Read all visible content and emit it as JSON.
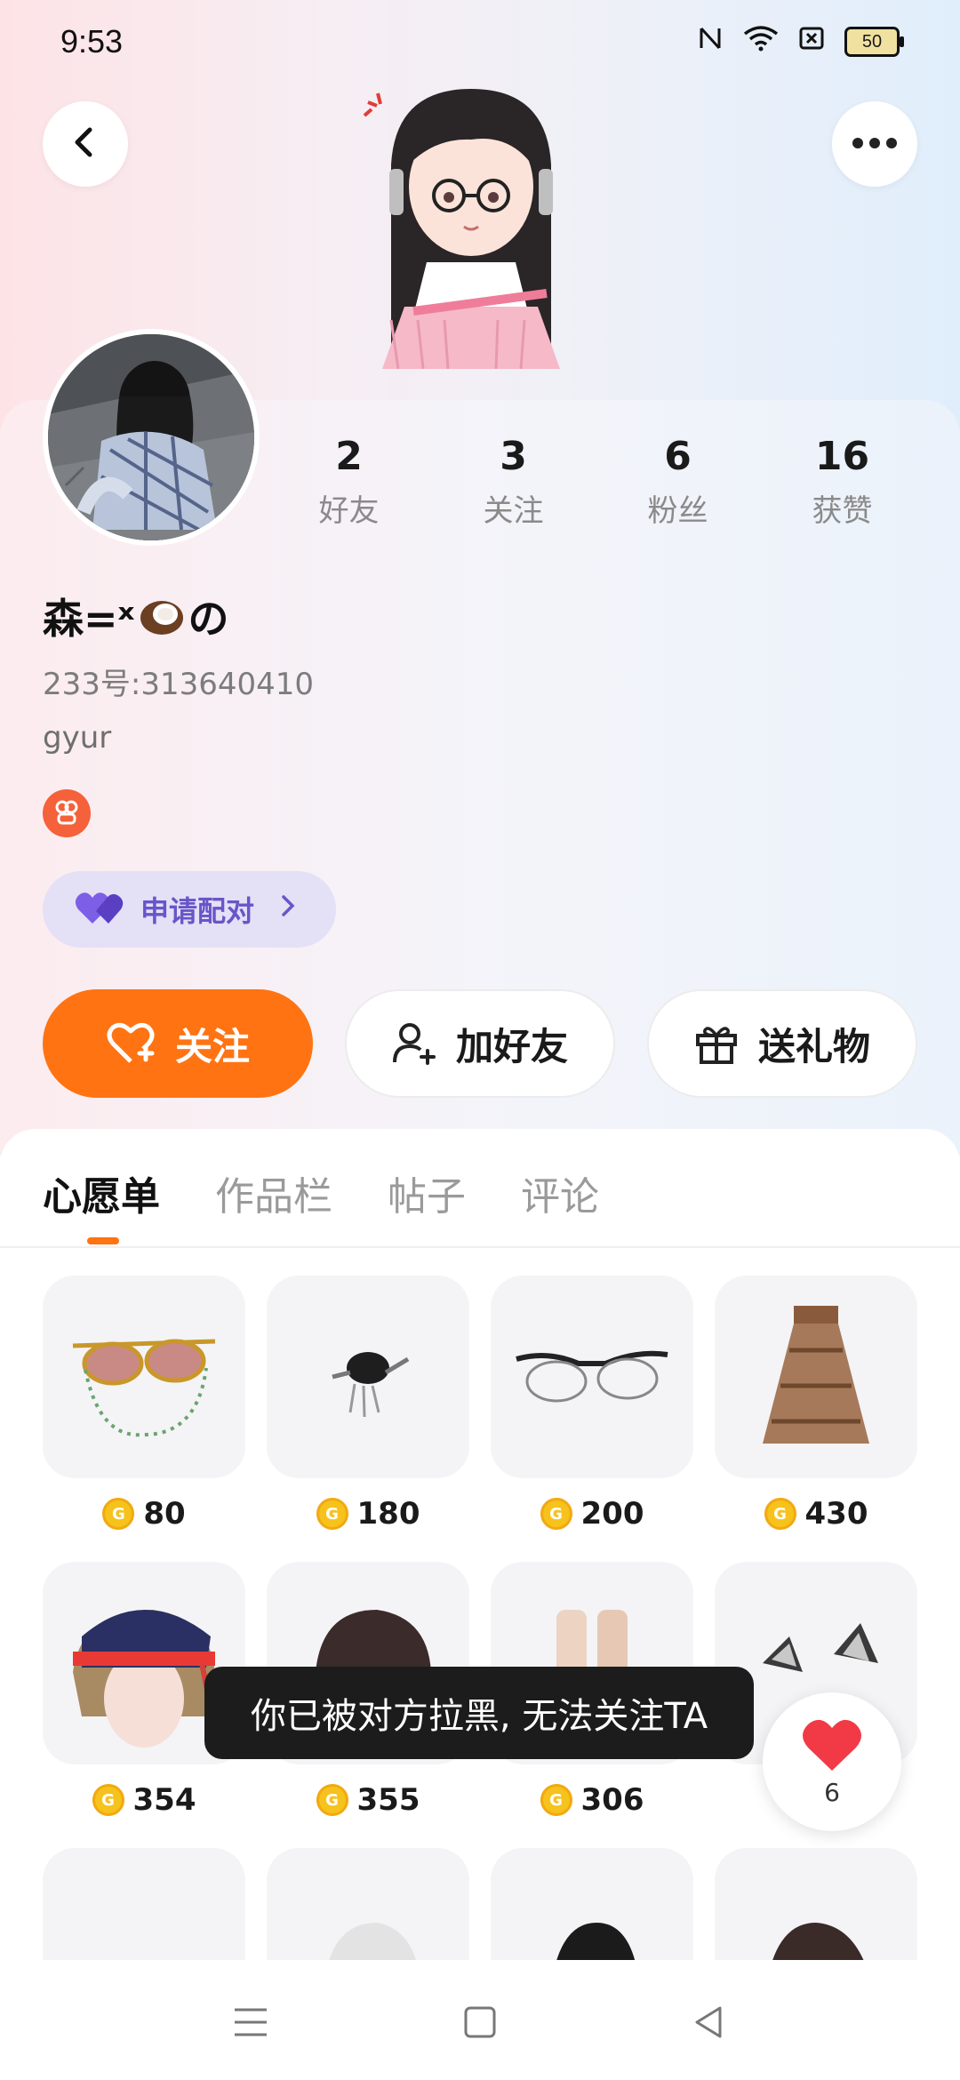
{
  "status_bar": {
    "time": "9:53",
    "battery": "50"
  },
  "header": {
    "avatar_icon": "3d-avatar-girl-icon"
  },
  "profile": {
    "stats": [
      {
        "value": "2",
        "label": "好友"
      },
      {
        "value": "3",
        "label": "关注"
      },
      {
        "value": "6",
        "label": "粉丝"
      },
      {
        "value": "16",
        "label": "获赞"
      }
    ],
    "name_prefix": "森=ˣ",
    "name_suffix": "の",
    "uid": "233号:313640410",
    "bio": "gyur",
    "pair_label": "申请配对"
  },
  "actions": {
    "follow": "关注",
    "add_friend": "加好友",
    "gift": "送礼物"
  },
  "tabs": [
    "心愿单",
    "作品栏",
    "帖子",
    "评论"
  ],
  "items": [
    {
      "price": "80",
      "icon": "sunglasses-chain-icon"
    },
    {
      "price": "180",
      "icon": "hair-clip-icon"
    },
    {
      "price": "200",
      "icon": "glasses-icon"
    },
    {
      "price": "430",
      "icon": "skirt-icon"
    },
    {
      "price": "354",
      "icon": "hat-hair-icon"
    },
    {
      "price": "355",
      "icon": "dark-hair-icon"
    },
    {
      "price": "306",
      "icon": "boots-icon"
    },
    {
      "price": "",
      "icon": "ears-icon"
    },
    {
      "price": "",
      "icon": "shoes-icon"
    },
    {
      "price": "",
      "icon": "white-hair-icon"
    },
    {
      "price": "",
      "icon": "black-hair-icon"
    },
    {
      "price": "",
      "icon": "brown-hair-icon"
    }
  ],
  "toast": "你已被对方拉黑, 无法关注TA",
  "like": {
    "count": "6"
  },
  "colors": {
    "accent": "#ff7313",
    "pair": "#6955c9",
    "coin": "#f6c21c"
  }
}
